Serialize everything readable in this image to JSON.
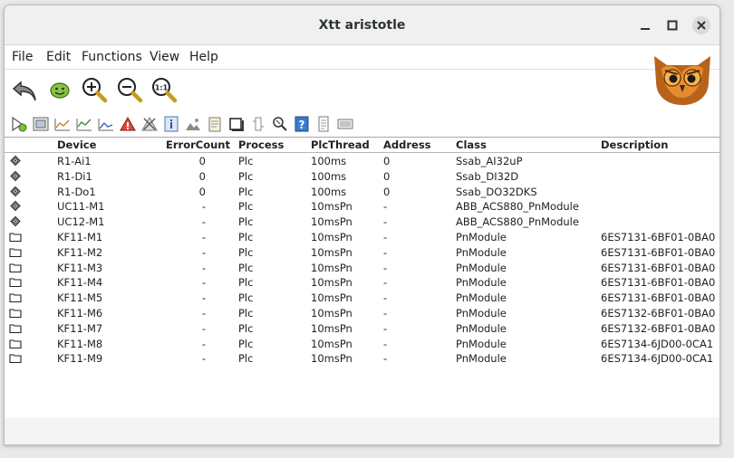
{
  "window": {
    "title": "Xtt aristotle"
  },
  "menu": [
    "File",
    "Edit",
    "Functions",
    "View",
    "Help"
  ],
  "toolbar1": [
    {
      "icon": "back-arrow-icon"
    },
    {
      "icon": "smiley-icon"
    },
    {
      "icon": "zoom-in-icon"
    },
    {
      "icon": "zoom-out-icon"
    },
    {
      "icon": "zoom-reset-icon"
    }
  ],
  "toolbar2": [
    {
      "icon": "open-plc-trace-icon"
    },
    {
      "icon": "graph-icon"
    },
    {
      "icon": "trend-icon"
    },
    {
      "icon": "fast-curve-icon"
    },
    {
      "icon": "history-icon"
    },
    {
      "icon": "alarm-icon"
    },
    {
      "icon": "block-events-icon"
    },
    {
      "icon": "info-icon"
    },
    {
      "icon": "picture-icon"
    },
    {
      "icon": "notes-icon"
    },
    {
      "icon": "object-icon"
    },
    {
      "icon": "crossreference-icon"
    },
    {
      "icon": "search-icon"
    },
    {
      "icon": "help-icon"
    },
    {
      "icon": "document-icon"
    },
    {
      "icon": "list-icon"
    }
  ],
  "table": {
    "columns": [
      "Device",
      "ErrorCount",
      "Process",
      "PlcThread",
      "Address",
      "Class",
      "Description"
    ],
    "rows": [
      {
        "icon": "module",
        "device": "R1-Ai1",
        "errorcount": "0",
        "process": "Plc",
        "plcthread": "100ms",
        "address": "0",
        "class": "Ssab_AI32uP",
        "description": ""
      },
      {
        "icon": "module",
        "device": "R1-Di1",
        "errorcount": "0",
        "process": "Plc",
        "plcthread": "100ms",
        "address": "0",
        "class": "Ssab_DI32D",
        "description": ""
      },
      {
        "icon": "module",
        "device": "R1-Do1",
        "errorcount": "0",
        "process": "Plc",
        "plcthread": "100ms",
        "address": "0",
        "class": "Ssab_DO32DKS",
        "description": ""
      },
      {
        "icon": "module",
        "device": "UC11-M1",
        "errorcount": "-",
        "process": "Plc",
        "plcthread": "10msPn",
        "address": "-",
        "class": "ABB_ACS880_PnModule",
        "description": ""
      },
      {
        "icon": "module",
        "device": "UC12-M1",
        "errorcount": "-",
        "process": "Plc",
        "plcthread": "10msPn",
        "address": "-",
        "class": "ABB_ACS880_PnModule",
        "description": ""
      },
      {
        "icon": "folder",
        "device": "KF11-M1",
        "errorcount": "-",
        "process": "Plc",
        "plcthread": "10msPn",
        "address": "-",
        "class": "PnModule",
        "description": "6ES7131-6BF01-0BA0"
      },
      {
        "icon": "folder",
        "device": "KF11-M2",
        "errorcount": "-",
        "process": "Plc",
        "plcthread": "10msPn",
        "address": "-",
        "class": "PnModule",
        "description": "6ES7131-6BF01-0BA0"
      },
      {
        "icon": "folder",
        "device": "KF11-M3",
        "errorcount": "-",
        "process": "Plc",
        "plcthread": "10msPn",
        "address": "-",
        "class": "PnModule",
        "description": "6ES7131-6BF01-0BA0"
      },
      {
        "icon": "folder",
        "device": "KF11-M4",
        "errorcount": "-",
        "process": "Plc",
        "plcthread": "10msPn",
        "address": "-",
        "class": "PnModule",
        "description": "6ES7131-6BF01-0BA0"
      },
      {
        "icon": "folder",
        "device": "KF11-M5",
        "errorcount": "-",
        "process": "Plc",
        "plcthread": "10msPn",
        "address": "-",
        "class": "PnModule",
        "description": "6ES7131-6BF01-0BA0"
      },
      {
        "icon": "folder",
        "device": "KF11-M6",
        "errorcount": "-",
        "process": "Plc",
        "plcthread": "10msPn",
        "address": "-",
        "class": "PnModule",
        "description": "6ES7132-6BF01-0BA0"
      },
      {
        "icon": "folder",
        "device": "KF11-M7",
        "errorcount": "-",
        "process": "Plc",
        "plcthread": "10msPn",
        "address": "-",
        "class": "PnModule",
        "description": "6ES7132-6BF01-0BA0"
      },
      {
        "icon": "folder",
        "device": "KF11-M8",
        "errorcount": "-",
        "process": "Plc",
        "plcthread": "10msPn",
        "address": "-",
        "class": "PnModule",
        "description": "6ES7134-6JD00-0CA1"
      },
      {
        "icon": "folder",
        "device": "KF11-M9",
        "errorcount": "-",
        "process": "Plc",
        "plcthread": "10msPn",
        "address": "-",
        "class": "PnModule",
        "description": "6ES7134-6JD00-0CA1"
      }
    ]
  }
}
